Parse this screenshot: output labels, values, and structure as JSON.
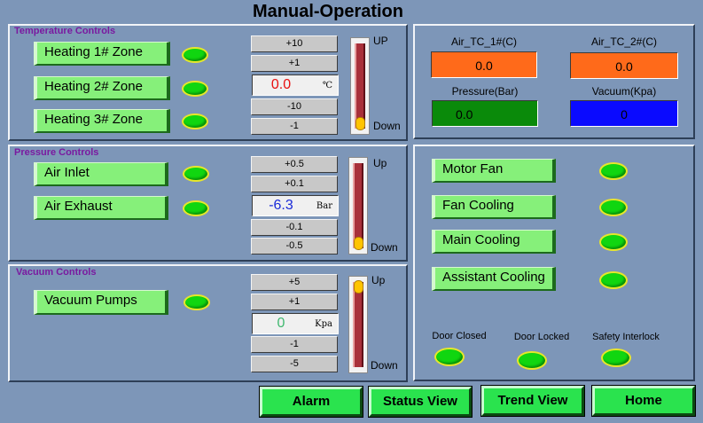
{
  "title": "Manual-Operation",
  "temperature": {
    "panel_title": "Temperature Controls",
    "zones": [
      "Heating 1# Zone",
      "Heating 2# Zone",
      "Heating 3# Zone"
    ],
    "steps_up": [
      "+10",
      "+1"
    ],
    "steps_down": [
      "-10",
      "-1"
    ],
    "value": "0.0",
    "unit": "℃",
    "slider_up": "UP",
    "slider_down": "Down",
    "slider_level": 0
  },
  "pressure": {
    "panel_title": "Pressure Controls",
    "items": [
      "Air Inlet",
      "Air Exhaust"
    ],
    "steps_up": [
      "+0.5",
      "+0.1"
    ],
    "steps_down": [
      "-0.1",
      "-0.5"
    ],
    "value": "-6.3",
    "unit": "Bar",
    "slider_up": "Up",
    "slider_down": "Down",
    "slider_level": 0
  },
  "vacuum": {
    "panel_title": "Vacuum Controls",
    "items": [
      "Vacuum Pumps"
    ],
    "steps_up": [
      "+5",
      "+1"
    ],
    "steps_down": [
      "-1",
      "-5"
    ],
    "value": "0",
    "unit": "Kpa",
    "slider_up": "Up",
    "slider_down": "Down",
    "slider_level": 1
  },
  "readings": {
    "air_tc1": {
      "label": "Air_TC_1#(C)",
      "value": "0.0",
      "color": "#ff6a1a"
    },
    "air_tc2": {
      "label": "Air_TC_2#(C)",
      "value": "0.0",
      "color": "#ff6a1a"
    },
    "pressure": {
      "label": "Pressure(Bar)",
      "value": "0.0",
      "color": "#0a8a0a"
    },
    "vacuum": {
      "label": "Vacuum(Kpa)",
      "value": "0",
      "color": "#0a0aff"
    }
  },
  "equipment": [
    "Motor Fan",
    "Fan Cooling",
    "Main Cooling",
    "Assistant Cooling"
  ],
  "status": [
    "Door Closed",
    "Door Locked",
    "Safety Interlock"
  ],
  "nav": [
    "Alarm",
    "Status View",
    "Trend View",
    "Home"
  ],
  "colors": {
    "background": "#7d96b8",
    "button_green": "#86f07a",
    "led_green": "#10d610",
    "nav_green": "#2ae34e",
    "panel_title": "#7a1aa0"
  }
}
